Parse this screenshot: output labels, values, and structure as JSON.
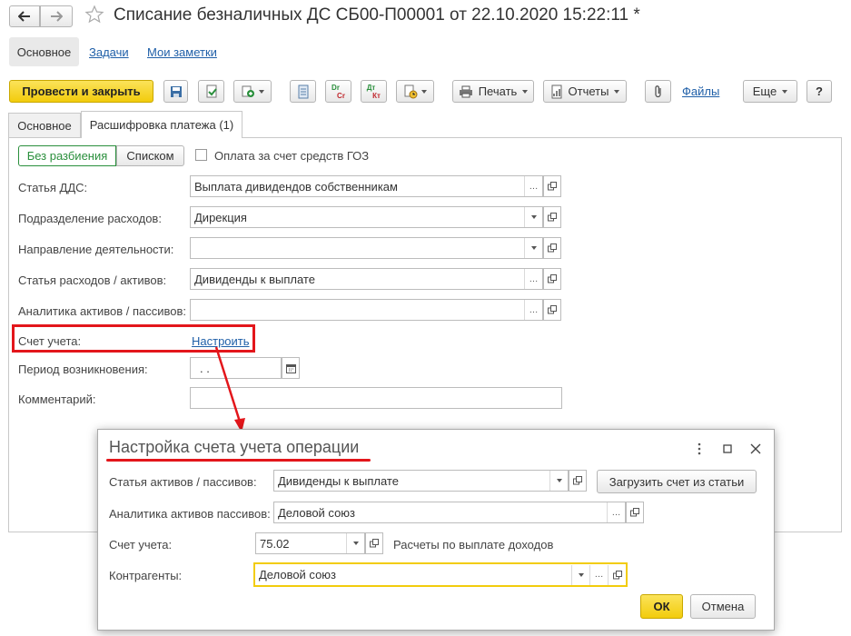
{
  "window": {
    "title": "Списание безналичных ДС СБ00-П00001 от 22.10.2020 15:22:11 *",
    "back_icon": "arrow-left-icon",
    "forward_icon": "arrow-right-icon",
    "favorite_icon": "star-icon"
  },
  "nav_tabs": [
    "Основное",
    "Задачи",
    "Мои заметки"
  ],
  "toolbar": {
    "post_close": "Провести и закрыть",
    "print": "Печать",
    "reports": "Отчеты",
    "files": "Файлы",
    "more": "Еще",
    "help": "?",
    "dt_kt_1": "Dr",
    "dt_kt_2": "Cr",
    "dt_kt_3": "Дт",
    "dt_kt_4": "Кт"
  },
  "form_tabs": [
    "Основное",
    "Расшифровка платежа (1)"
  ],
  "mode": {
    "no_split": "Без разбиения",
    "list": "Списком",
    "goz_checkbox": "Оплата за счет средств ГОЗ"
  },
  "fields": [
    {
      "label": "Статья ДДС:",
      "value": "Выплата дивидендов собственникам"
    },
    {
      "label": "Подразделение расходов:",
      "value": "Дирекция"
    },
    {
      "label": "Направление деятельности:",
      "value": ""
    },
    {
      "label": "Статья расходов / активов:",
      "value": "Дивиденды к выплате"
    },
    {
      "label": "Аналитика активов / пассивов:",
      "value": ""
    }
  ],
  "account": {
    "label": "Счет учета:",
    "link": "Настроить"
  },
  "period": {
    "label": "Период возникновения:",
    "value": " .  ."
  },
  "comment": {
    "label": "Комментарий:",
    "value": ""
  },
  "dialog": {
    "title": "Настройка счета учета операции",
    "rows": [
      {
        "label": "Статья активов / пассивов:",
        "value": "Дивиденды к выплате"
      },
      {
        "label": "Аналитика активов пассивов:",
        "value": "Деловой союз"
      },
      {
        "label": "Счет учета:",
        "value": "75.02"
      },
      {
        "label": "Контрагенты:",
        "value": "Деловой союз"
      }
    ],
    "load_button": "Загрузить счет из статьи",
    "account_desc": "Расчеты по выплате доходов",
    "ok": "ОК",
    "cancel": "Отмена"
  },
  "colors": {
    "accent": "#f5d20e",
    "annotation": "#e3161b",
    "link": "#1f5fa8",
    "green": "#2a8f3c"
  }
}
